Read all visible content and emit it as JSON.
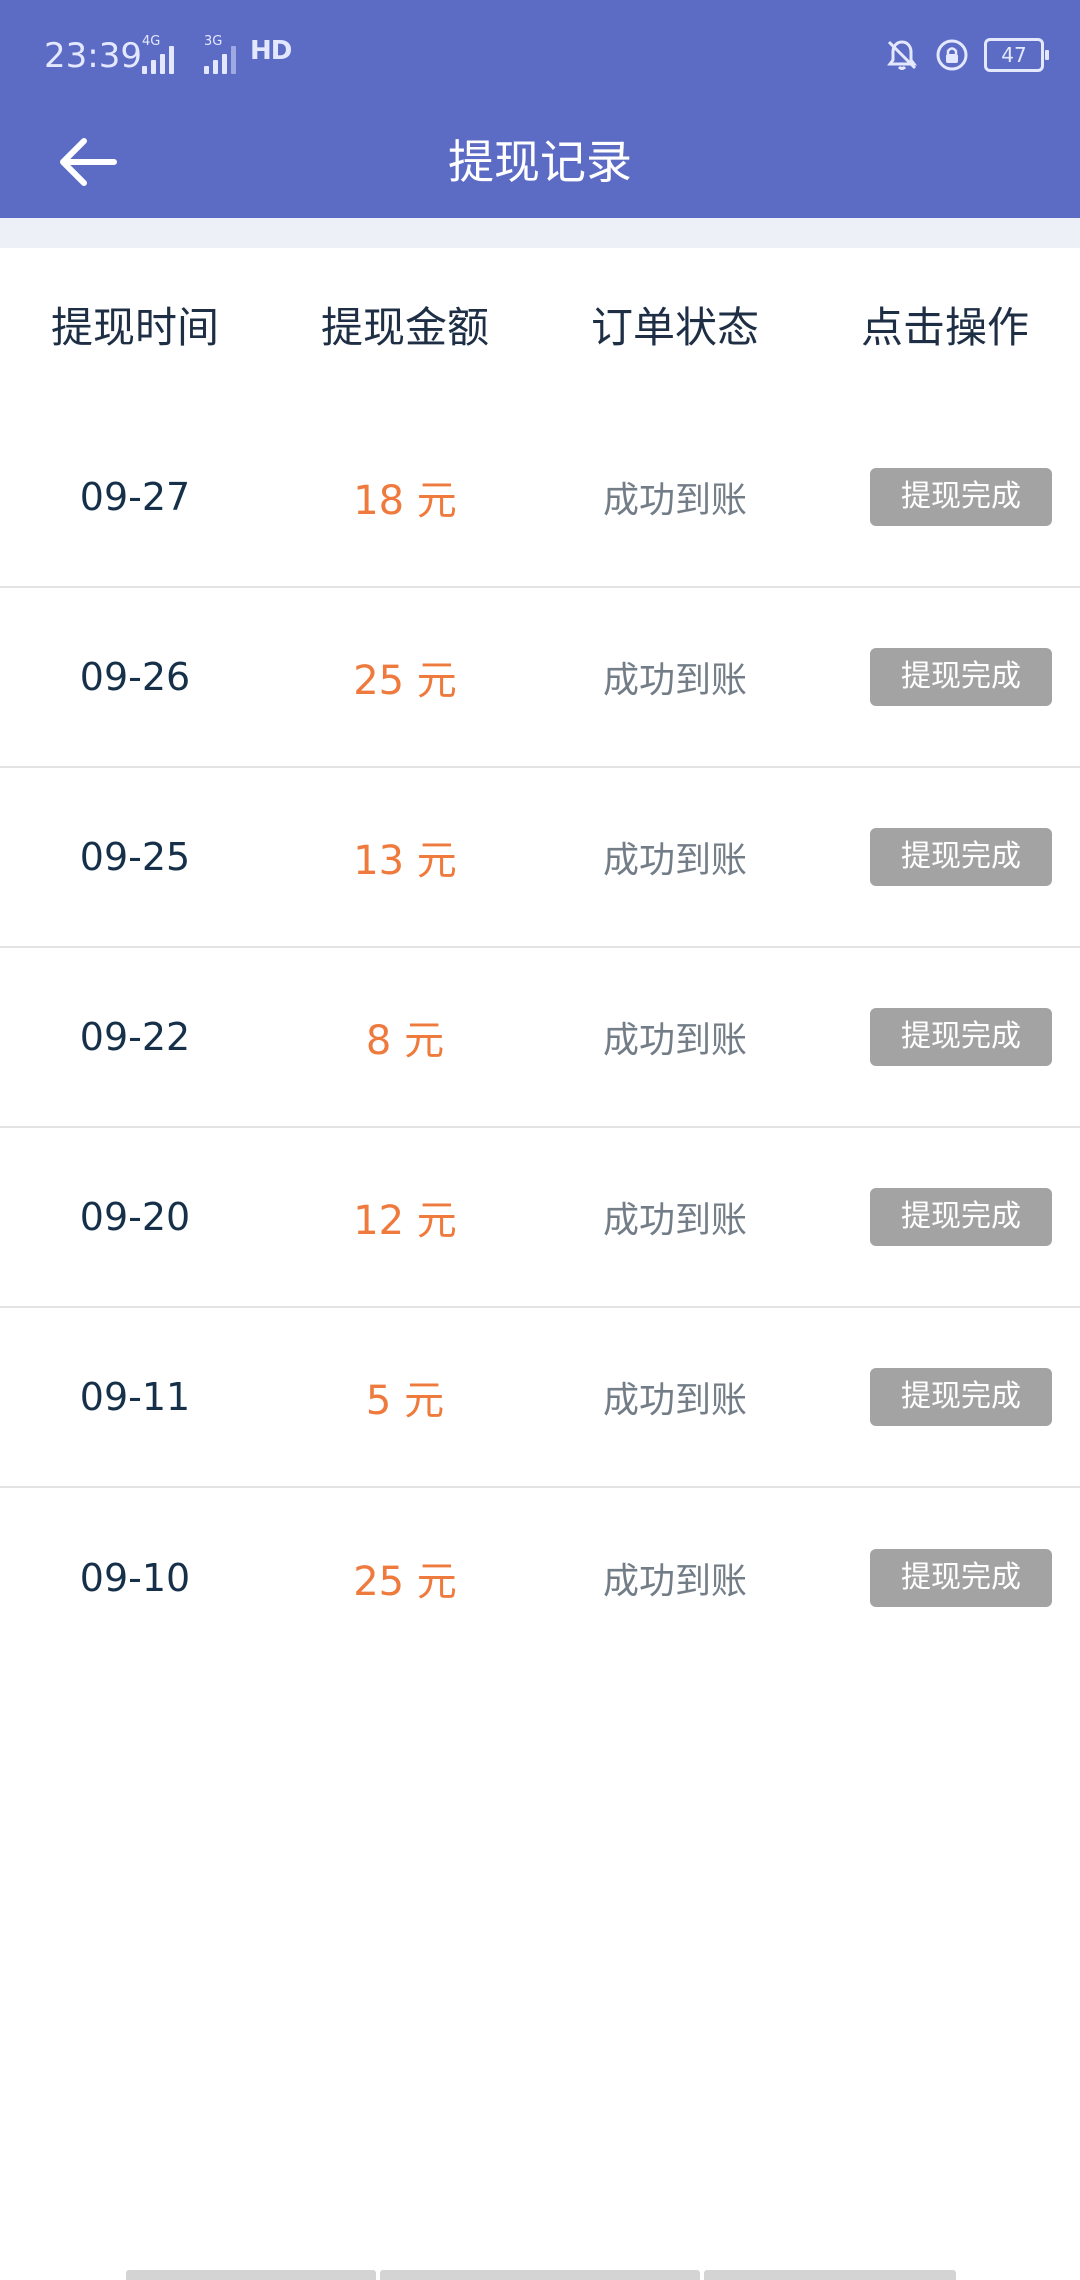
{
  "status_bar": {
    "time": "23:39",
    "signal_1_label": "4G",
    "signal_2_label": "3G",
    "hd_label": "HD",
    "battery": "47"
  },
  "header": {
    "title": "提现记录",
    "background_color": "#5c6cc4"
  },
  "table": {
    "columns": [
      "提现时间",
      "提现金额",
      "订单状态",
      "点击操作"
    ],
    "rows": [
      {
        "date": "09-27",
        "amount": "18 元",
        "status": "成功到账",
        "action": "提现完成"
      },
      {
        "date": "09-26",
        "amount": "25 元",
        "status": "成功到账",
        "action": "提现完成"
      },
      {
        "date": "09-25",
        "amount": "13 元",
        "status": "成功到账",
        "action": "提现完成"
      },
      {
        "date": "09-22",
        "amount": "8 元",
        "status": "成功到账",
        "action": "提现完成"
      },
      {
        "date": "09-20",
        "amount": "12 元",
        "status": "成功到账",
        "action": "提现完成"
      },
      {
        "date": "09-11",
        "amount": "5 元",
        "status": "成功到账",
        "action": "提现完成"
      },
      {
        "date": "09-10",
        "amount": "25 元",
        "status": "成功到账",
        "action": "提现完成"
      }
    ]
  },
  "colors": {
    "amount": "#ef7a3e",
    "action_button": "#a3a3a3"
  }
}
